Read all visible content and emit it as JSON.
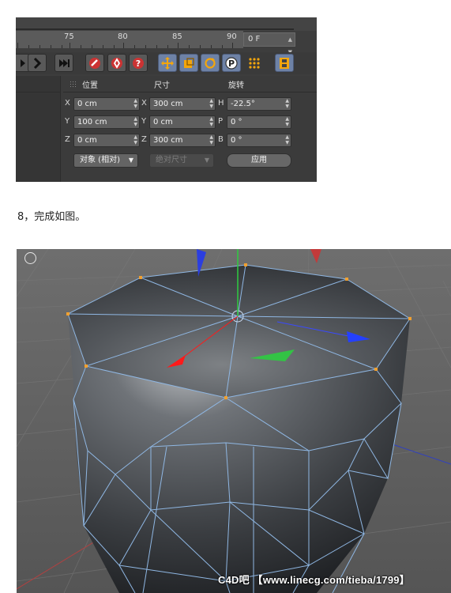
{
  "timeline": {
    "ticks": [
      "75",
      "80",
      "85",
      "90"
    ],
    "frame_value": "0 F"
  },
  "toolbar": {
    "icons": [
      "play-icon",
      "go-to-end-icon",
      "record-keys-icon",
      "autokey-icon",
      "help-key-icon",
      "move-icon",
      "scale-icon",
      "rotate-icon",
      "param-icon",
      "points-grid-icon",
      "film-icon"
    ]
  },
  "attributes": {
    "headers": {
      "position": "位置",
      "size": "尺寸",
      "rotation": "旋转"
    },
    "rows": [
      {
        "axis_p": "X",
        "pos": "0 cm",
        "axis_s": "X",
        "size": "300 cm",
        "axis_r": "H",
        "rot": "-22.5°"
      },
      {
        "axis_p": "Y",
        "pos": "100 cm",
        "axis_s": "Y",
        "size": "0 cm",
        "axis_r": "P",
        "rot": "0 °"
      },
      {
        "axis_p": "Z",
        "pos": "0 cm",
        "axis_s": "Z",
        "size": "300 cm",
        "axis_r": "B",
        "rot": "0 °"
      }
    ],
    "mode_select": "对象 (相对)",
    "size_select": "绝对尺寸",
    "apply_label": "应用"
  },
  "caption": "8，完成如图。",
  "viewport": {
    "watermark": "C4D吧 【www.linecg.com/tieba/1799】"
  },
  "colors": {
    "highlight_button": "#6e82a6",
    "mesh_edge": "#8fb7e3",
    "vertex": "#f0a030",
    "axis_x": "#2440ff",
    "axis_y": "#2ecc40",
    "axis_z": "#ff1a1a"
  }
}
